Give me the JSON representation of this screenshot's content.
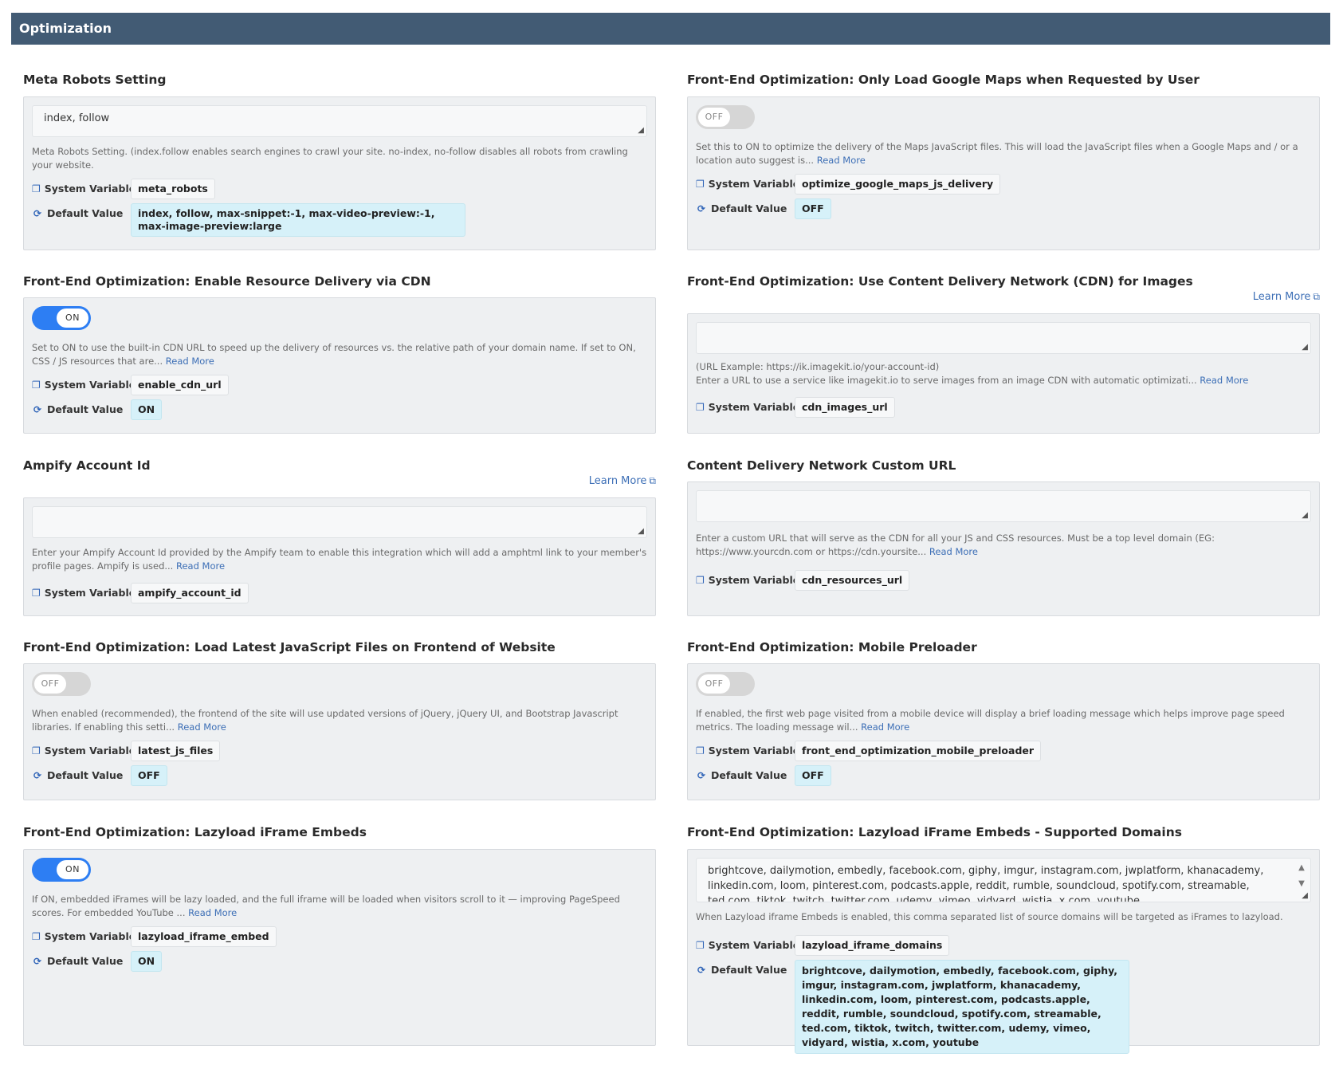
{
  "header": {
    "title": "Optimization"
  },
  "common": {
    "system_variable_label": "System Variable",
    "default_value_label": "Default Value",
    "read_more": "Read More",
    "learn_more": "Learn More"
  },
  "settings": {
    "meta_robots": {
      "title": "Meta Robots Setting",
      "value": "index, follow",
      "description": "Meta Robots Setting. (index.follow enables search engines to crawl your site. no-index, no-follow disables all robots from crawling your website.",
      "system_variable": "meta_robots",
      "default_value": "index, follow, max-snippet:-1, max-video-preview:-1, max-image-preview:large"
    },
    "google_maps": {
      "title": "Front-End Optimization: Only Load Google Maps when Requested by User",
      "toggle": "OFF",
      "description": "Set this to ON to optimize the delivery of the Maps JavaScript files. This will load the JavaScript files when a Google Maps and / or a location auto suggest is...",
      "system_variable": "optimize_google_maps_js_delivery",
      "default_value": "OFF"
    },
    "cdn_delivery": {
      "title": "Front-End Optimization: Enable Resource Delivery via CDN",
      "toggle": "ON",
      "description": "Set to ON to use the built-in CDN URL to speed up the delivery of resources vs. the relative path of your domain name. If set to ON, CSS / JS resources that are...",
      "system_variable": "enable_cdn_url",
      "default_value": "ON"
    },
    "cdn_images": {
      "title": "Front-End Optimization: Use Content Delivery Network (CDN) for Images",
      "value": "",
      "example": "(URL Example: https://ik.imagekit.io/your-account-id)",
      "description": "Enter a URL to use a service like imagekit.io to serve images from an image CDN with automatic optimizati...",
      "system_variable": "cdn_images_url"
    },
    "ampify": {
      "title": "Ampify Account Id",
      "value": "",
      "description": "Enter your Ampify Account Id provided by the Ampify team to enable this integration which will add a amphtml link to your member's profile pages. Ampify is used...",
      "system_variable": "ampify_account_id"
    },
    "cdn_custom_url": {
      "title": "Content Delivery Network Custom URL",
      "value": "",
      "description": "Enter a custom URL that will serve as the CDN for all your JS and CSS resources. Must be a top level domain (EG: https://www.yourcdn.com or https://cdn.yoursite...",
      "system_variable": "cdn_resources_url"
    },
    "latest_js": {
      "title": "Front-End Optimization: Load Latest JavaScript Files on Frontend of Website",
      "toggle": "OFF",
      "description": "When enabled (recommended), the frontend of the site will use updated versions of jQuery, jQuery UI, and Bootstrap Javascript libraries. If enabling this setti...",
      "system_variable": "latest_js_files",
      "default_value": "OFF"
    },
    "mobile_preloader": {
      "title": "Front-End Optimization: Mobile Preloader",
      "toggle": "OFF",
      "description": "If enabled, the first web page visited from a mobile device will display a brief loading message which helps improve page speed metrics. The loading message wil...",
      "system_variable": "front_end_optimization_mobile_preloader",
      "default_value": "OFF"
    },
    "lazyload_iframe": {
      "title": "Front-End Optimization: Lazyload iFrame Embeds",
      "toggle": "ON",
      "description": "If ON, embedded iFrames will be lazy loaded, and the full iframe will be loaded when visitors scroll to it — improving PageSpeed scores. For embedded YouTube ...",
      "system_variable": "lazyload_iframe_embed",
      "default_value": "ON"
    },
    "lazyload_domains": {
      "title": "Front-End Optimization: Lazyload iFrame Embeds - Supported Domains",
      "value": "brightcove, dailymotion, embedly, facebook.com, giphy, imgur, instagram.com, jwplatform, khanacademy, linkedin.com, loom, pinterest.com, podcasts.apple, reddit, rumble, soundcloud, spotify.com, streamable, ted.com, tiktok, twitch, twitter.com, udemy, vimeo, vidyard, wistia, x.com, youtube",
      "description": "When Lazyload iframe Embeds is enabled, this comma separated list of source domains will be targeted as iFrames to lazyload.",
      "system_variable": "lazyload_iframe_domains",
      "default_value": "brightcove, dailymotion, embedly, facebook.com, giphy, imgur, instagram.com, jwplatform, khanacademy, linkedin.com, loom, pinterest.com, podcasts.apple, reddit, rumble, soundcloud, spotify.com, streamable, ted.com, tiktok, twitch, twitter.com, udemy, vimeo, vidyard, wistia, x.com, youtube"
    }
  },
  "icons": {
    "system_variable": "copy-icon",
    "default_value": "refresh-icon",
    "learn_more": "external-link-icon"
  },
  "colors": {
    "header_bg": "#425b74",
    "toggle_on": "#2d7ef3",
    "toggle_off": "#d6d6d6",
    "default_chip": "#d6f1f9",
    "link": "#3d6fb6"
  }
}
